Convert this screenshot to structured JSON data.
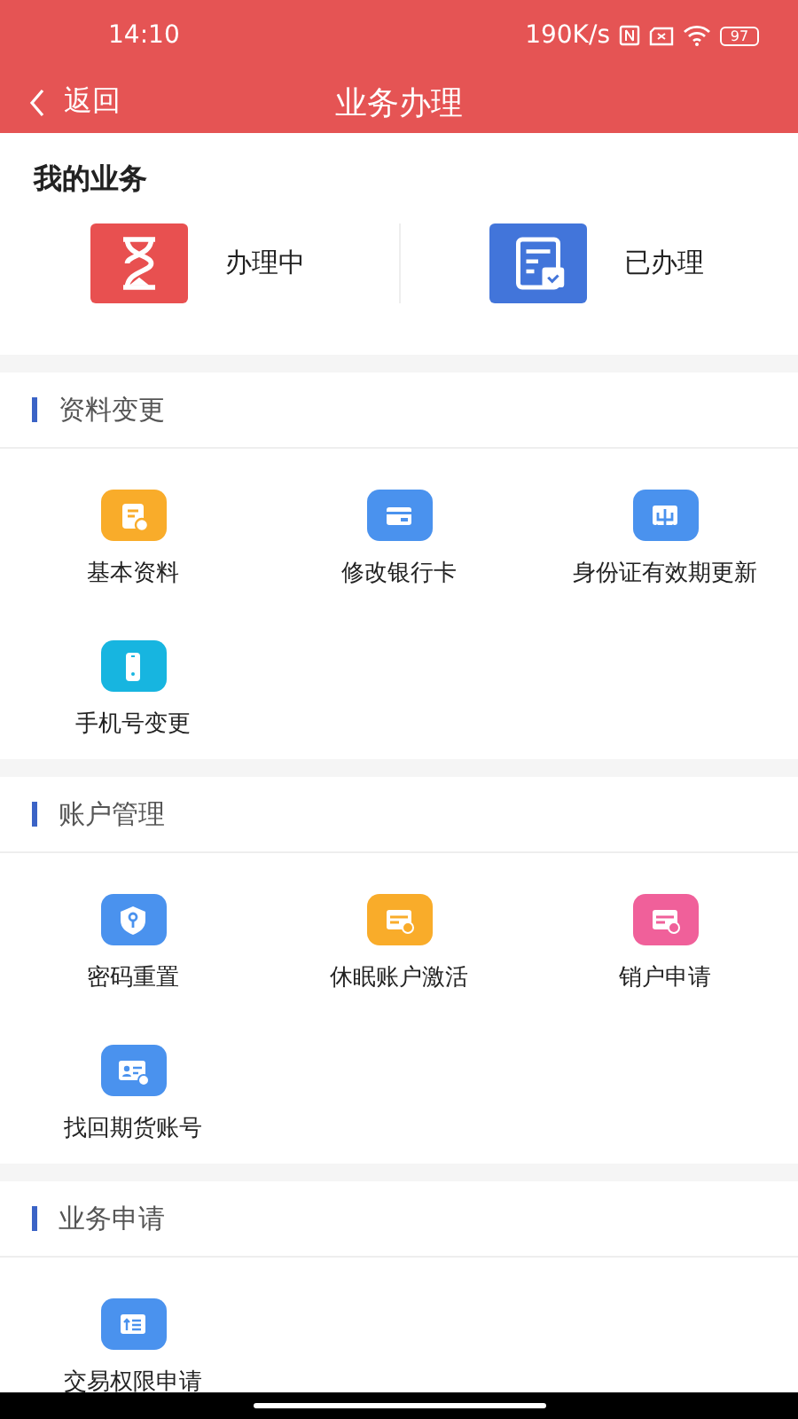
{
  "status_bar": {
    "time": "14:10",
    "speed": "190K/s",
    "battery": "97"
  },
  "nav": {
    "back": "返回",
    "title": "业务办理"
  },
  "my_business": {
    "title": "我的业务",
    "cards": [
      {
        "label": "办理中",
        "color": "#e85050"
      },
      {
        "label": "已办理",
        "color": "#4275da"
      }
    ]
  },
  "sections": [
    {
      "title": "资料变更",
      "items": [
        {
          "label": "基本资料",
          "color": "#f9ac2a"
        },
        {
          "label": "修改银行卡",
          "color": "#4a92ee"
        },
        {
          "label": "身份证有效期更新",
          "color": "#4a92ee"
        },
        {
          "label": "手机号变更",
          "color": "#17b5e0"
        }
      ]
    },
    {
      "title": "账户管理",
      "items": [
        {
          "label": "密码重置",
          "color": "#4a92ee"
        },
        {
          "label": "休眠账户激活",
          "color": "#f9ac2a"
        },
        {
          "label": "销户申请",
          "color": "#f0609a"
        },
        {
          "label": "找回期货账号",
          "color": "#4a92ee"
        }
      ]
    },
    {
      "title": "业务申请",
      "items": [
        {
          "label": "交易权限申请",
          "color": "#4a92ee"
        }
      ]
    }
  ]
}
